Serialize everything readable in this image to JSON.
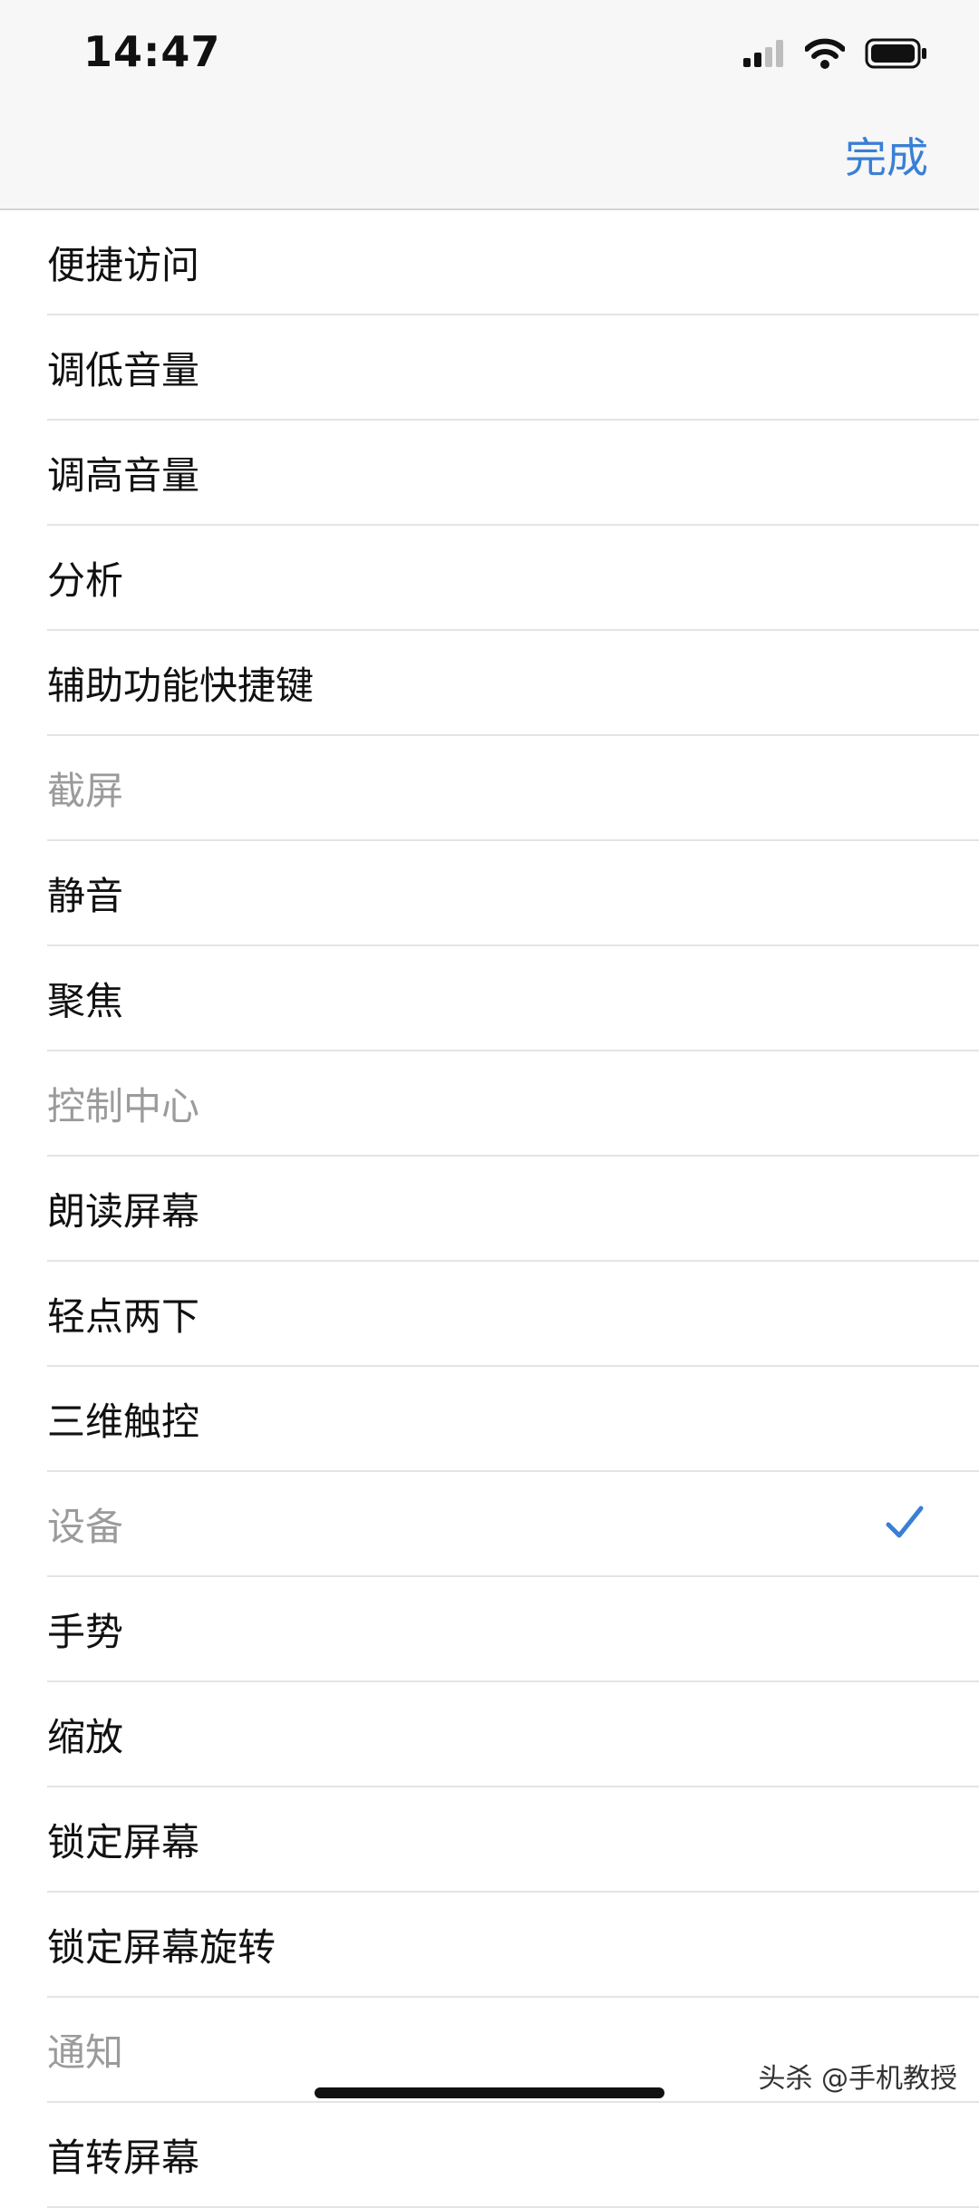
{
  "status_bar": {
    "time": "14:47",
    "signal_icon": "cellular-signal-icon",
    "wifi_icon": "wifi-icon",
    "battery_icon": "battery-icon"
  },
  "nav": {
    "done_label": "完成",
    "accent_color": "#3a7fd5"
  },
  "items": [
    {
      "label": "便捷访问",
      "enabled": true,
      "checked": false
    },
    {
      "label": "调低音量",
      "enabled": true,
      "checked": false
    },
    {
      "label": "调高音量",
      "enabled": true,
      "checked": false
    },
    {
      "label": "分析",
      "enabled": true,
      "checked": false
    },
    {
      "label": "辅助功能快捷键",
      "enabled": true,
      "checked": false
    },
    {
      "label": "截屏",
      "enabled": false,
      "checked": false
    },
    {
      "label": "静音",
      "enabled": true,
      "checked": false
    },
    {
      "label": "聚焦",
      "enabled": true,
      "checked": false
    },
    {
      "label": "控制中心",
      "enabled": false,
      "checked": false
    },
    {
      "label": "朗读屏幕",
      "enabled": true,
      "checked": false
    },
    {
      "label": "轻点两下",
      "enabled": true,
      "checked": false
    },
    {
      "label": "三维触控",
      "enabled": true,
      "checked": false
    },
    {
      "label": "设备",
      "enabled": false,
      "checked": true
    },
    {
      "label": "手势",
      "enabled": true,
      "checked": false
    },
    {
      "label": "缩放",
      "enabled": true,
      "checked": false
    },
    {
      "label": "锁定屏幕",
      "enabled": true,
      "checked": false
    },
    {
      "label": "锁定屏幕旋转",
      "enabled": true,
      "checked": false
    },
    {
      "label": "通知",
      "enabled": false,
      "checked": false
    },
    {
      "label": "首转屏幕",
      "enabled": true,
      "checked": false
    }
  ],
  "watermark": "头杀 @手机教授"
}
